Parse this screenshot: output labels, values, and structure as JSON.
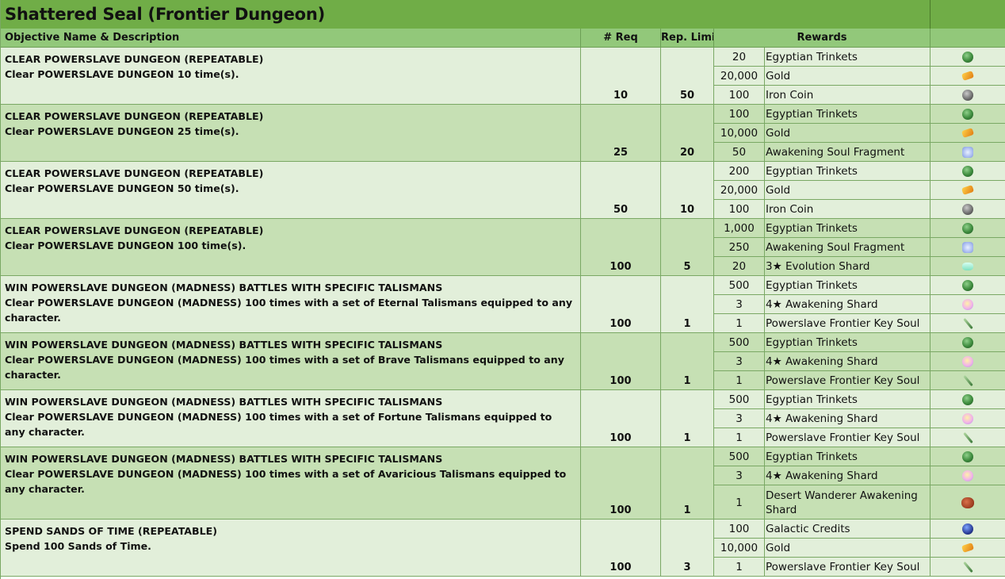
{
  "sheet": {
    "title": "Shattered Seal (Frontier Dungeon)",
    "headers": {
      "objective": "Objective Name & Description",
      "req": "# Req",
      "limit": "Rep. Limit",
      "rewards": "Rewards"
    },
    "rows": [
      {
        "title": "CLEAR POWERSLAVE DUNGEON (REPEATABLE)",
        "text": "Clear POWERSLAVE DUNGEON 10 time(s).",
        "req": "10",
        "limit": "50",
        "rewards": [
          {
            "qty": "20",
            "name": "Egyptian Trinkets",
            "icon": "trinket"
          },
          {
            "qty": "20,000",
            "name": "Gold",
            "icon": "gold"
          },
          {
            "qty": "100",
            "name": "Iron Coin",
            "icon": "iron"
          }
        ]
      },
      {
        "title": "CLEAR POWERSLAVE DUNGEON (REPEATABLE)",
        "text": "Clear POWERSLAVE DUNGEON 25 time(s).",
        "req": "25",
        "limit": "20",
        "rewards": [
          {
            "qty": "100",
            "name": "Egyptian Trinkets",
            "icon": "trinket"
          },
          {
            "qty": "10,000",
            "name": "Gold",
            "icon": "gold"
          },
          {
            "qty": "50",
            "name": "Awakening Soul Fragment",
            "icon": "soul"
          }
        ]
      },
      {
        "title": "CLEAR POWERSLAVE DUNGEON (REPEATABLE)",
        "text": "Clear POWERSLAVE DUNGEON 50 time(s).",
        "req": "50",
        "limit": "10",
        "rewards": [
          {
            "qty": "200",
            "name": "Egyptian Trinkets",
            "icon": "trinket"
          },
          {
            "qty": "20,000",
            "name": "Gold",
            "icon": "gold"
          },
          {
            "qty": "100",
            "name": "Iron Coin",
            "icon": "iron"
          }
        ]
      },
      {
        "title": "CLEAR POWERSLAVE DUNGEON (REPEATABLE)",
        "text": "Clear POWERSLAVE DUNGEON 100 time(s).",
        "req": "100",
        "limit": "5",
        "rewards": [
          {
            "qty": "1,000",
            "name": "Egyptian Trinkets",
            "icon": "trinket"
          },
          {
            "qty": "250",
            "name": "Awakening Soul Fragment",
            "icon": "soul"
          },
          {
            "qty": "20",
            "name": "3★ Evolution Shard",
            "icon": "evo"
          }
        ]
      },
      {
        "title": "WIN POWERSLAVE DUNGEON (MADNESS) BATTLES WITH SPECIFIC TALISMANS",
        "text": "Clear POWERSLAVE DUNGEON (MADNESS) 100 times with a set of Eternal Talismans equipped to any character.",
        "req": "100",
        "limit": "1",
        "rewards": [
          {
            "qty": "500",
            "name": "Egyptian Trinkets",
            "icon": "trinket"
          },
          {
            "qty": "3",
            "name": "4★ Awakening Shard",
            "icon": "awk4"
          },
          {
            "qty": "1",
            "name": "Powerslave Frontier Key Soul",
            "icon": "key"
          }
        ]
      },
      {
        "title": "WIN POWERSLAVE DUNGEON (MADNESS) BATTLES WITH SPECIFIC TALISMANS",
        "text": "Clear POWERSLAVE DUNGEON (MADNESS) 100 times with a set of Brave Talismans equipped to any character.",
        "req": "100",
        "limit": "1",
        "rewards": [
          {
            "qty": "500",
            "name": "Egyptian Trinkets",
            "icon": "trinket"
          },
          {
            "qty": "3",
            "name": "4★ Awakening Shard",
            "icon": "awk4"
          },
          {
            "qty": "1",
            "name": "Powerslave Frontier Key Soul",
            "icon": "key"
          }
        ]
      },
      {
        "title": "WIN POWERSLAVE DUNGEON (MADNESS) BATTLES WITH SPECIFIC TALISMANS",
        "text": "Clear POWERSLAVE DUNGEON (MADNESS) 100 times with a set of Fortune Talismans equipped to any character.",
        "req": "100",
        "limit": "1",
        "rewards": [
          {
            "qty": "500",
            "name": "Egyptian Trinkets",
            "icon": "trinket"
          },
          {
            "qty": "3",
            "name": "4★ Awakening Shard",
            "icon": "awk4"
          },
          {
            "qty": "1",
            "name": "Powerslave Frontier Key Soul",
            "icon": "key"
          }
        ]
      },
      {
        "title": "WIN POWERSLAVE DUNGEON (MADNESS) BATTLES WITH SPECIFIC TALISMANS",
        "text": "Clear POWERSLAVE DUNGEON (MADNESS) 100 times with a set of Avaricious Talismans equipped to any character.",
        "req": "100",
        "limit": "1",
        "rewards": [
          {
            "qty": "500",
            "name": "Egyptian Trinkets",
            "icon": "trinket"
          },
          {
            "qty": "3",
            "name": "4★ Awakening Shard",
            "icon": "awk4"
          },
          {
            "qty": "1",
            "name": "Desert Wanderer Awakening Shard",
            "icon": "desert"
          }
        ]
      },
      {
        "title": "SPEND SANDS OF TIME (REPEATABLE)",
        "text": "Spend 100 Sands of Time.",
        "req": "100",
        "limit": "3",
        "rewards": [
          {
            "qty": "100",
            "name": "Galactic Credits",
            "icon": "galactic"
          },
          {
            "qty": "10,000",
            "name": "Gold",
            "icon": "gold"
          },
          {
            "qty": "1",
            "name": "Powerslave Frontier Key Soul",
            "icon": "key"
          }
        ]
      }
    ]
  }
}
